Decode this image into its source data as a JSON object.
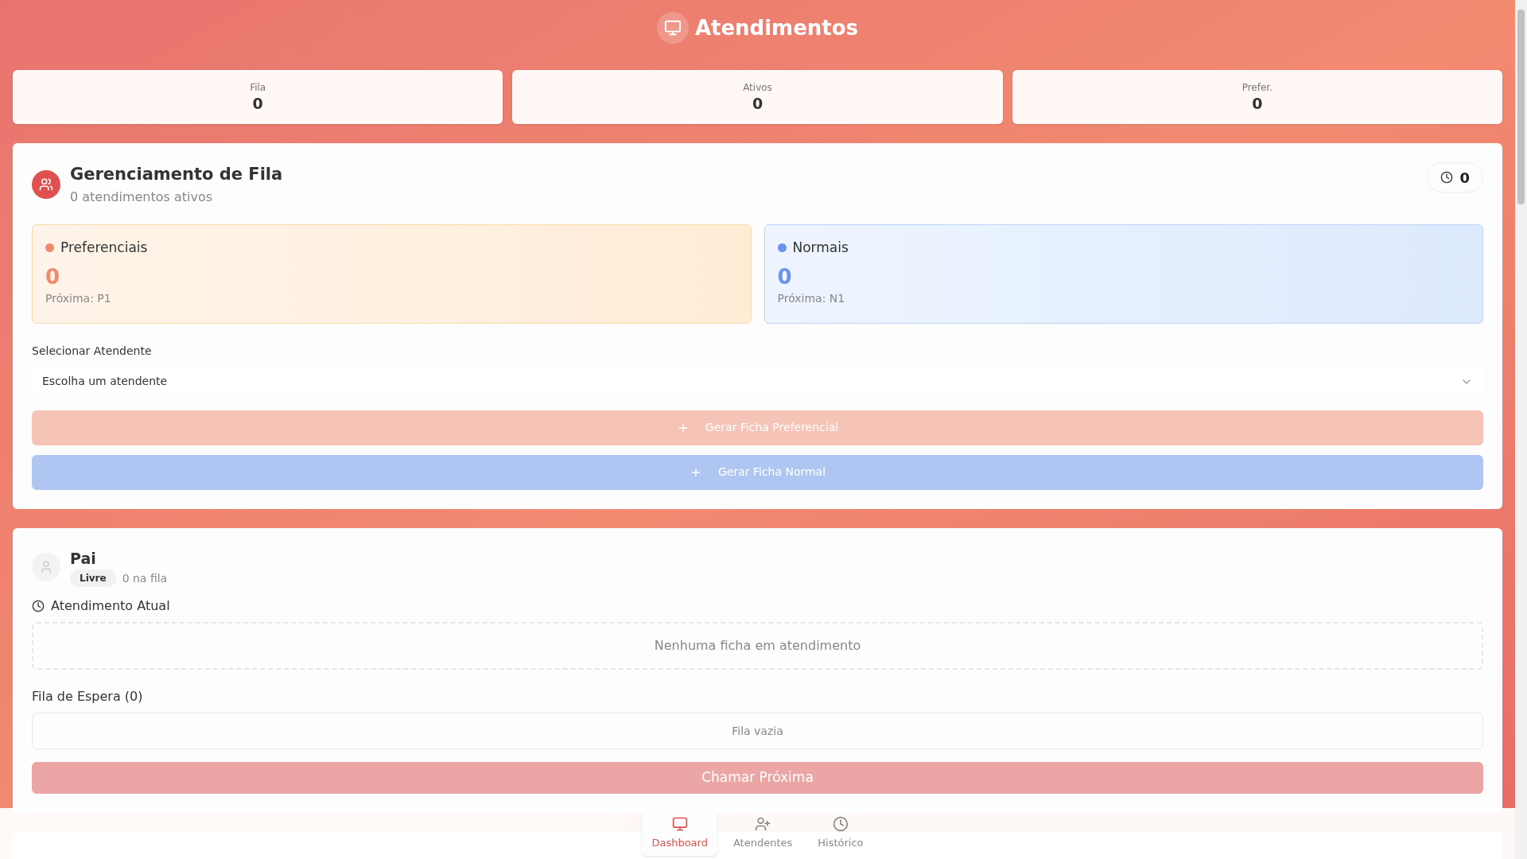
{
  "header": {
    "title": "Atendimentos"
  },
  "stats": [
    {
      "label": "Fila",
      "value": "0"
    },
    {
      "label": "Ativos",
      "value": "0"
    },
    {
      "label": "Prefer.",
      "value": "0"
    }
  ],
  "queue_panel": {
    "title": "Gerenciamento de Fila",
    "subtitle": "0 atendimentos ativos",
    "badge": "0",
    "queues": [
      {
        "kind": "preferential",
        "label": "Preferenciais",
        "count": "0",
        "next": "Próxima: P1"
      },
      {
        "kind": "normal",
        "label": "Normais",
        "count": "0",
        "next": "Próxima: N1"
      }
    ],
    "select": {
      "label": "Selecionar Atendente",
      "value": "Escolha um atendente"
    },
    "buttons": [
      {
        "kind": "preferential",
        "label": "Gerar Ficha Preferencial",
        "disabled": true
      },
      {
        "kind": "normal",
        "label": "Gerar Ficha Normal",
        "disabled": true
      }
    ]
  },
  "attendants": [
    {
      "name": "Pai",
      "status": "Livre",
      "queue_count": "0 na fila",
      "current_label": "Atendimento Atual",
      "current_empty": "Nenhuma ficha em atendimento",
      "waiting_label": "Fila de Espera (0)",
      "waiting_empty": "Fila vazia",
      "call_button": {
        "label": "Chamar Próxima",
        "disabled": true
      }
    }
  ],
  "nav": [
    {
      "label": "Dashboard",
      "selected": true
    },
    {
      "label": "Atendentes",
      "selected": false
    },
    {
      "label": "Histórico",
      "selected": false
    }
  ]
}
